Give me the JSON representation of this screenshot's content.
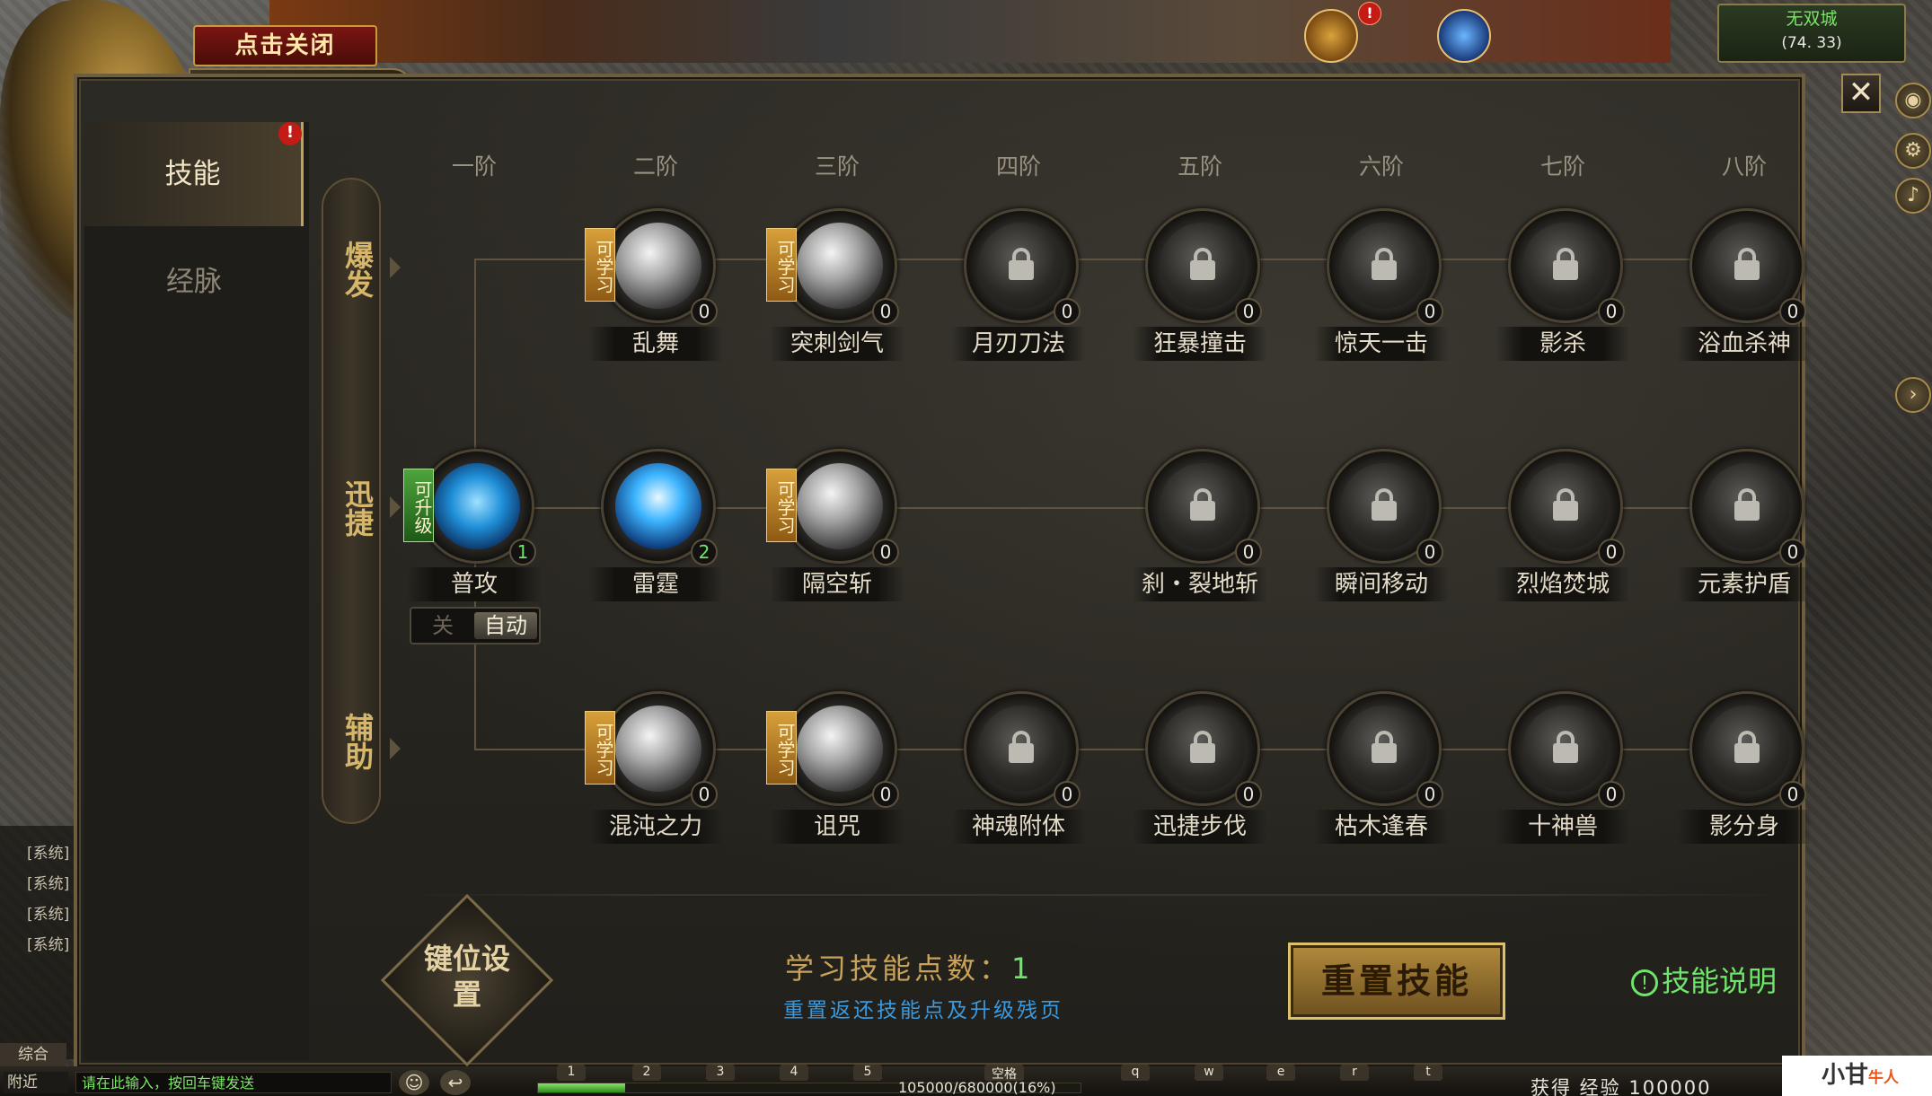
{
  "header": {
    "close_tip": "点击关闭",
    "panel_title": "技能",
    "city_name": "无双城",
    "city_coords": "(74. 33)",
    "top_alert": "!"
  },
  "tabs": [
    {
      "label": "技能",
      "active": true,
      "alert": "!"
    },
    {
      "label": "经脉",
      "active": false
    }
  ],
  "categories": [
    "爆发",
    "迅捷",
    "辅助"
  ],
  "tiers": [
    "一阶",
    "二阶",
    "三阶",
    "四阶",
    "五阶",
    "六阶",
    "七阶",
    "八阶"
  ],
  "skills": {
    "row1": [
      {
        "name": "乱舞",
        "level": "0",
        "tag": "可学习",
        "state": "learnable"
      },
      {
        "name": "突刺剑气",
        "level": "0",
        "tag": "可学习",
        "state": "learnable"
      },
      {
        "name": "月刃刀法",
        "level": "0",
        "state": "locked"
      },
      {
        "name": "狂暴撞击",
        "level": "0",
        "state": "locked"
      },
      {
        "name": "惊天一击",
        "level": "0",
        "state": "locked"
      },
      {
        "name": "影杀",
        "level": "0",
        "state": "locked"
      },
      {
        "name": "浴血杀神",
        "level": "0",
        "state": "locked"
      }
    ],
    "row2": [
      {
        "name": "普攻",
        "level": "1",
        "tag": "可升级",
        "state": "upgradable"
      },
      {
        "name": "雷霆",
        "level": "2",
        "state": "learned"
      },
      {
        "name": "隔空斩",
        "level": "0",
        "tag": "可学习",
        "state": "learnable"
      },
      {
        "name": "刹・裂地斩",
        "level": "0",
        "state": "locked"
      },
      {
        "name": "瞬间移动",
        "level": "0",
        "state": "locked"
      },
      {
        "name": "烈焰焚城",
        "level": "0",
        "state": "locked"
      },
      {
        "name": "元素护盾",
        "level": "0",
        "state": "locked"
      }
    ],
    "row3": [
      {
        "name": "混沌之力",
        "level": "0",
        "tag": "可学习",
        "state": "learnable"
      },
      {
        "name": "诅咒",
        "level": "0",
        "tag": "可学习",
        "state": "learnable"
      },
      {
        "name": "神魂附体",
        "level": "0",
        "state": "locked"
      },
      {
        "name": "迅捷步伐",
        "level": "0",
        "state": "locked"
      },
      {
        "name": "枯木逢春",
        "level": "0",
        "state": "locked"
      },
      {
        "name": "十神兽",
        "level": "0",
        "state": "locked"
      },
      {
        "name": "影分身",
        "level": "0",
        "state": "locked"
      }
    ]
  },
  "auto_toggle": {
    "off_label": "关",
    "on_label": "自动"
  },
  "footer": {
    "keybind_label": "键位设置",
    "points_label": "学习技能点数：",
    "points_value": "1",
    "reset_desc": "重置返还技能点及升级残页",
    "reset_button": "重置技能",
    "help_label": "技能说明",
    "help_icon": "!"
  },
  "chat": {
    "lines": [
      "[系统]",
      "[系统]",
      "[系统]",
      "[系统]"
    ],
    "tab": "综合",
    "channel": "附近",
    "input_placeholder": "请在此输入，按回车键发送"
  },
  "status": {
    "exp_text": "105000/680000(16%)",
    "exp_percent": 16,
    "hotkeys": [
      "1",
      "2",
      "3",
      "4",
      "5",
      "空格",
      "q",
      "w",
      "e",
      "r",
      "t"
    ],
    "gain_text": "获得  经验  100000"
  },
  "watermark": {
    "text": "小甘",
    "sub": "牛人"
  }
}
